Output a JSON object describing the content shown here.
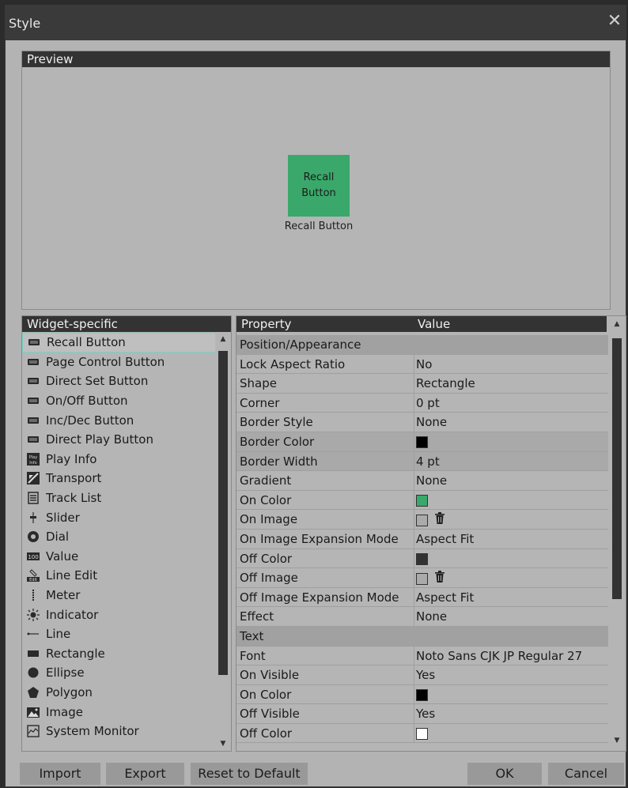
{
  "window": {
    "title": "Style",
    "close_glyph": "✕"
  },
  "preview": {
    "header": "Preview",
    "button_text_line1": "Recall",
    "button_text_line2": "Button",
    "caption": "Recall Button",
    "button_color": "#3aa86a"
  },
  "widgets": {
    "header": "Widget-specific",
    "items": [
      {
        "label": "Recall Button",
        "icon": "button-icon"
      },
      {
        "label": "Page Control Button",
        "icon": "button-icon"
      },
      {
        "label": "Direct Set Button",
        "icon": "button-icon"
      },
      {
        "label": "On/Off Button",
        "icon": "button-icon"
      },
      {
        "label": "Inc/Dec Button",
        "icon": "button-icon"
      },
      {
        "label": "Direct Play Button",
        "icon": "button-icon"
      },
      {
        "label": "Play Info",
        "icon": "play-info-icon",
        "icon_text": "Play Info"
      },
      {
        "label": "Transport",
        "icon": "transport-icon"
      },
      {
        "label": "Track List",
        "icon": "track-list-icon"
      },
      {
        "label": "Slider",
        "icon": "slider-icon"
      },
      {
        "label": "Dial",
        "icon": "dial-icon"
      },
      {
        "label": "Value",
        "icon": "value-icon",
        "icon_text": "100"
      },
      {
        "label": "Line Edit",
        "icon": "line-edit-icon",
        "icon_text": "Edit"
      },
      {
        "label": "Meter",
        "icon": "meter-icon"
      },
      {
        "label": "Indicator",
        "icon": "indicator-icon"
      },
      {
        "label": "Line",
        "icon": "line-icon"
      },
      {
        "label": "Rectangle",
        "icon": "rectangle-icon"
      },
      {
        "label": "Ellipse",
        "icon": "ellipse-icon"
      },
      {
        "label": "Polygon",
        "icon": "polygon-icon"
      },
      {
        "label": "Image",
        "icon": "image-icon"
      },
      {
        "label": "System Monitor",
        "icon": "system-monitor-icon"
      }
    ]
  },
  "properties": {
    "col_property": "Property",
    "col_value": "Value",
    "rows": [
      {
        "type": "group",
        "label": "Position/Appearance"
      },
      {
        "label": "Lock Aspect Ratio",
        "value": "No"
      },
      {
        "label": "Shape",
        "value": "Rectangle"
      },
      {
        "label": "Corner",
        "value": "0 pt"
      },
      {
        "label": "Border Style",
        "value": "None"
      },
      {
        "label": "Border Color",
        "swatch": "#000000",
        "highlight": true
      },
      {
        "label": "Border Width",
        "value": "4 pt",
        "highlight": true
      },
      {
        "label": "Gradient",
        "value": "None"
      },
      {
        "label": "On Color",
        "swatch": "#3aa86a"
      },
      {
        "label": "On Image",
        "swatch": "#aaaaaa",
        "trash": true
      },
      {
        "label": "On Image Expansion Mode",
        "value": "Aspect Fit"
      },
      {
        "label": "Off Color",
        "swatch": "#333333"
      },
      {
        "label": "Off Image",
        "swatch": "#aaaaaa",
        "trash": true
      },
      {
        "label": "Off Image Expansion Mode",
        "value": "Aspect Fit"
      },
      {
        "label": "Effect",
        "value": "None"
      },
      {
        "type": "group",
        "label": "Text"
      },
      {
        "label": "Font",
        "value": "Noto Sans CJK JP Regular 27"
      },
      {
        "label": "On Visible",
        "value": "Yes"
      },
      {
        "label": "On Color",
        "swatch": "#000000"
      },
      {
        "label": "Off Visible",
        "value": "Yes"
      },
      {
        "label": "Off Color",
        "swatch": "#ffffff"
      }
    ]
  },
  "buttons": {
    "import": "Import",
    "export": "Export",
    "reset": "Reset to Default",
    "ok": "OK",
    "cancel": "Cancel"
  }
}
